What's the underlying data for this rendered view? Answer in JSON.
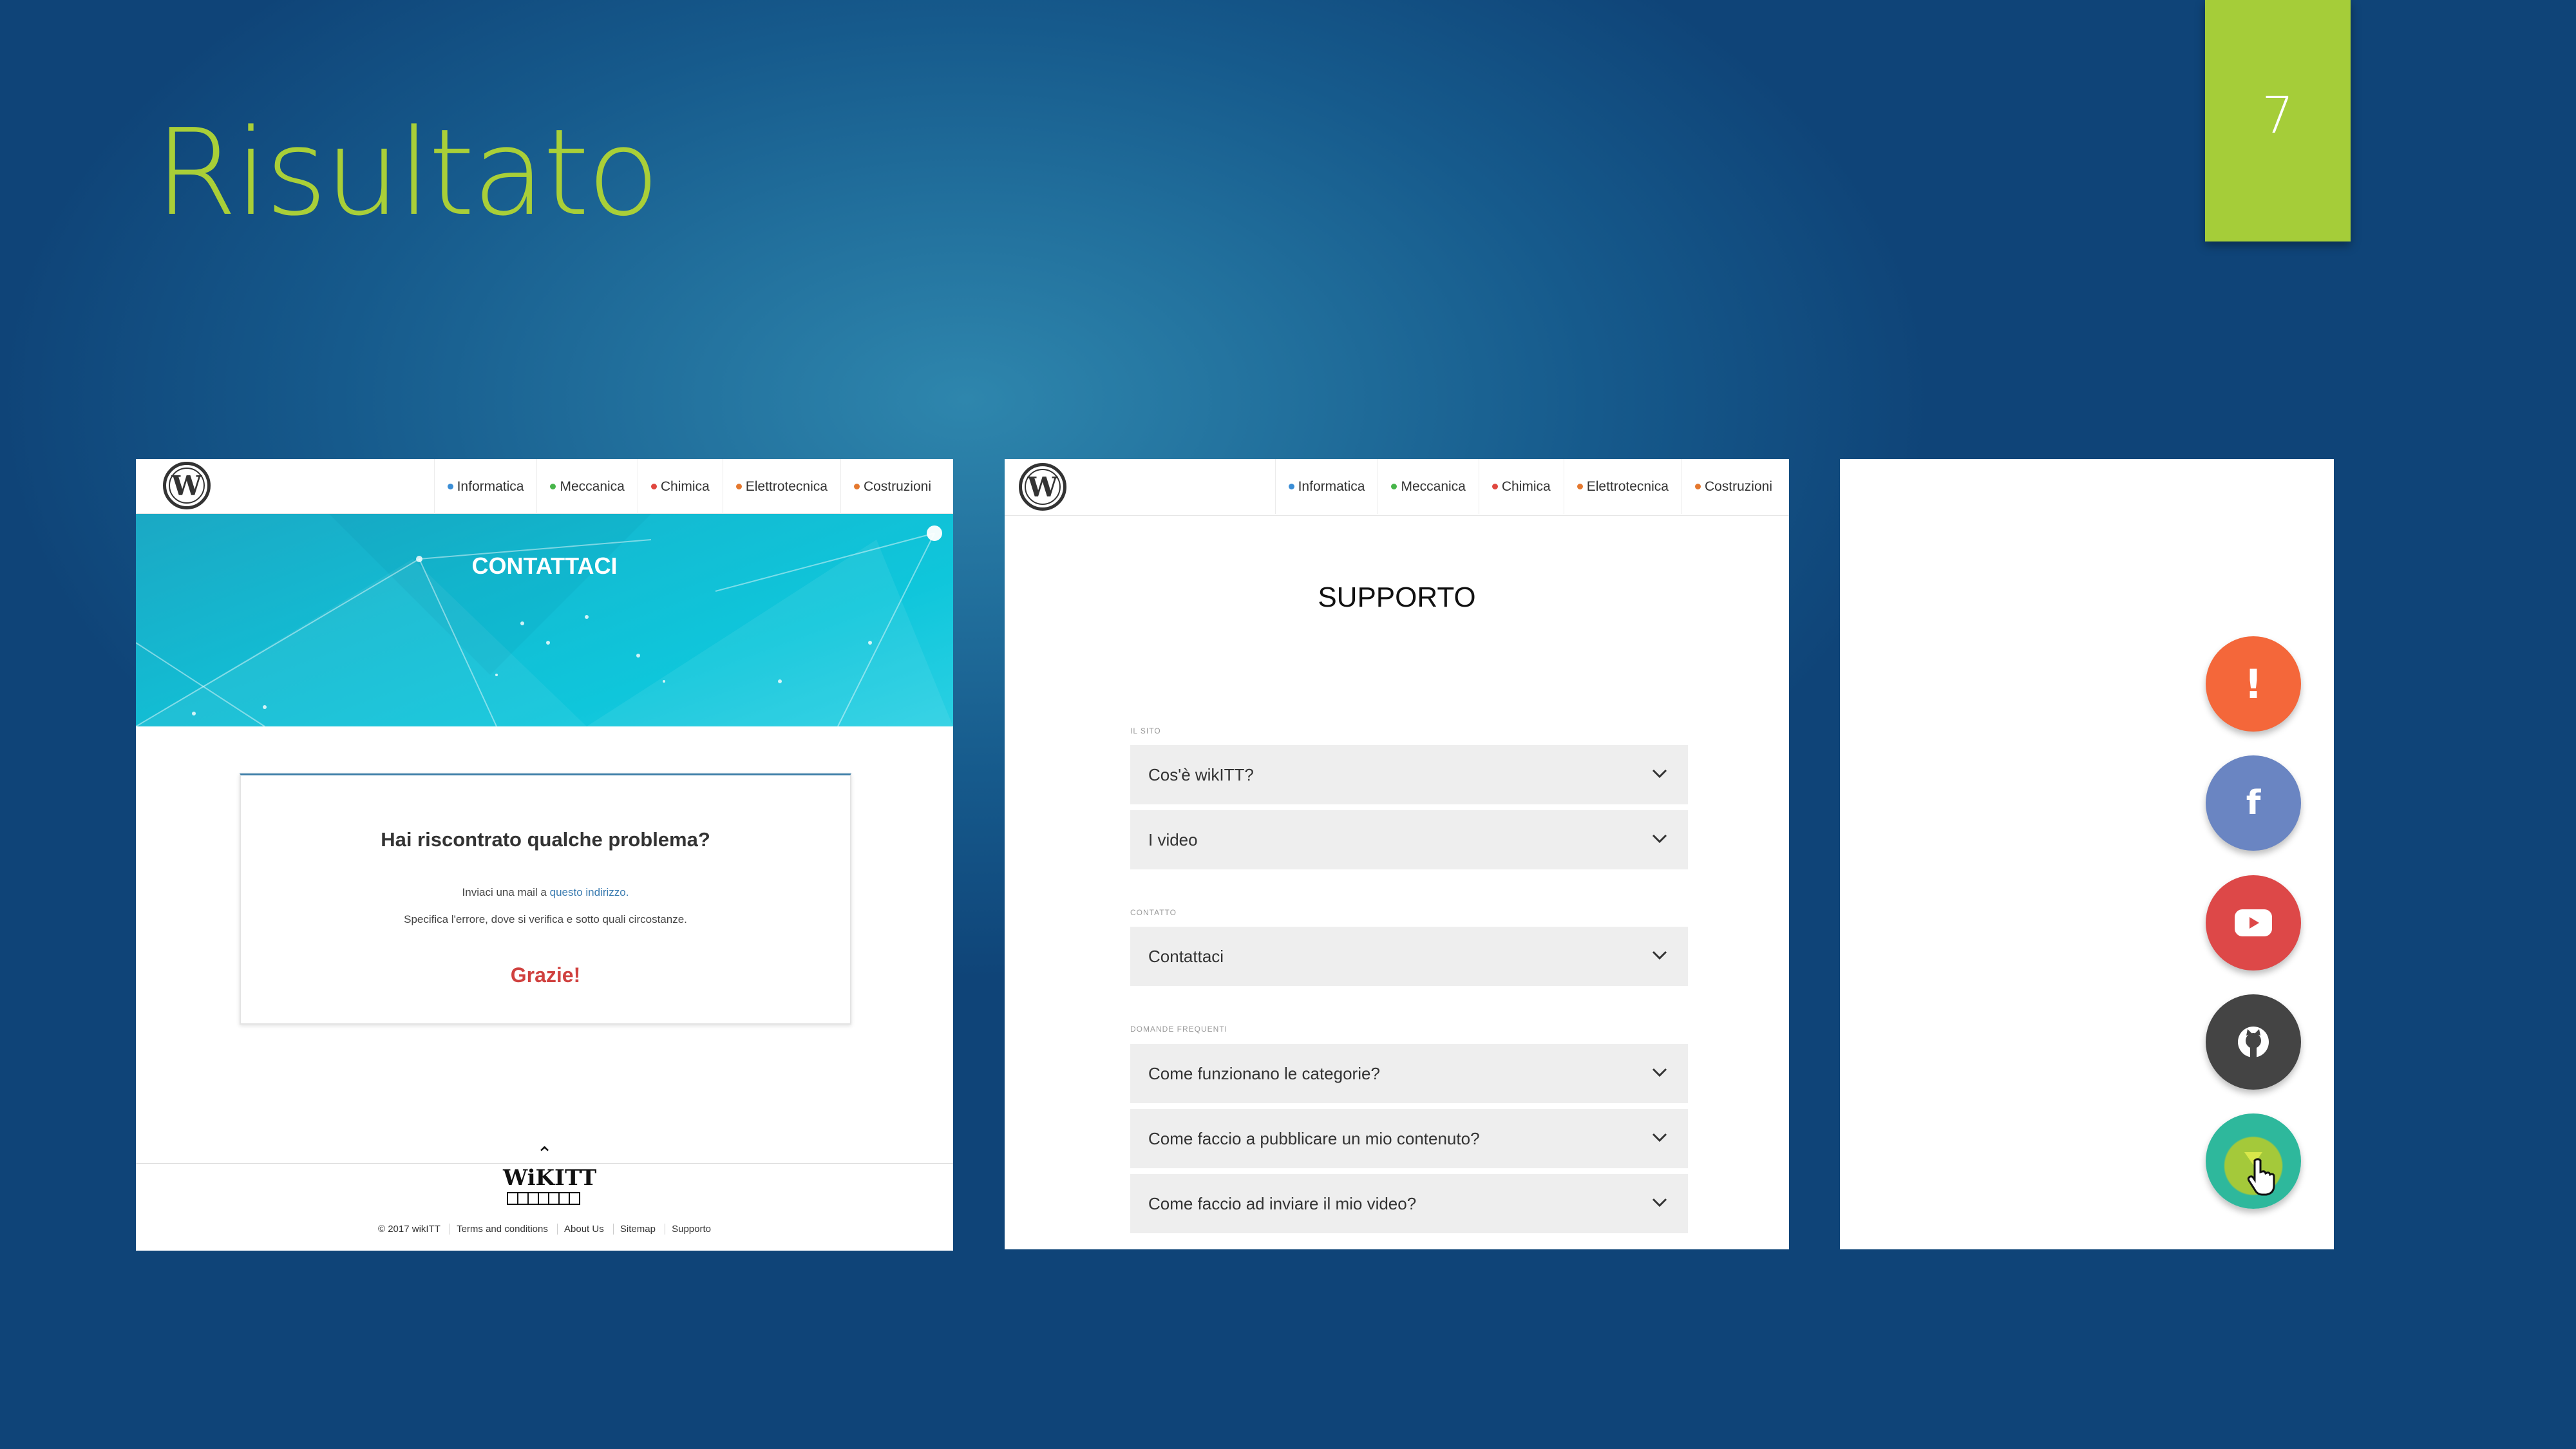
{
  "slide": {
    "title": "Risultato",
    "page_number": "7"
  },
  "nav": {
    "items": [
      {
        "label": "Informatica",
        "color": "#3b8ed6"
      },
      {
        "label": "Meccanica",
        "color": "#47b54a"
      },
      {
        "label": "Chimica",
        "color": "#e0473f"
      },
      {
        "label": "Elettrotecnica",
        "color": "#e5782e"
      },
      {
        "label": "Costruzioni",
        "color": "#e5782e"
      }
    ]
  },
  "contact_page": {
    "hero_title": "CONTATTACI",
    "card_title": "Hai riscontrato qualche problema?",
    "card_line1_prefix": "Inviaci una mail a",
    "card_line1_link": "questo indirizzo.",
    "card_line2": "Specifica l'errore, dove si verifica e sotto quali circostanze.",
    "card_thanks": "Grazie!",
    "footer_logo": "WiKITT",
    "footer_links": [
      "© 2017 wikITT",
      "Terms and conditions",
      "About Us",
      "Sitemap",
      "Supporto"
    ]
  },
  "support_page": {
    "heading": "SUPPORTO",
    "sections": [
      {
        "label": "IL SITO",
        "items": [
          "Cos'è wikITT?",
          "I video"
        ]
      },
      {
        "label": "CONTATTO",
        "items": [
          "Contattaci"
        ]
      },
      {
        "label": "DOMANDE FREQUENTI",
        "items": [
          "Come funzionano le categorie?",
          "Come faccio a pubblicare un mio contenuto?",
          "Come faccio ad inviare il mio video?"
        ]
      }
    ]
  },
  "fab_menu": {
    "buttons": [
      {
        "icon": "exclamation-icon",
        "color": "#f4673a"
      },
      {
        "icon": "facebook-icon",
        "color": "#6a85c2"
      },
      {
        "icon": "youtube-icon",
        "color": "#dd4848"
      },
      {
        "icon": "github-icon",
        "color": "#444444"
      },
      {
        "icon": "toggle-icon",
        "color": "#2eb89c"
      }
    ]
  }
}
